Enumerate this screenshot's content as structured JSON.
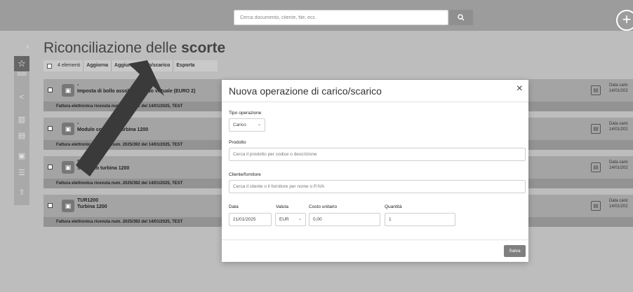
{
  "search": {
    "placeholder": "Cerca documento, cliente, file, ecc."
  },
  "icons": {
    "search": "search-icon",
    "add": "plus-circle-icon",
    "star": "star-icon",
    "share": "share-icon",
    "chart": "chart-icon",
    "stock": "stock-icon",
    "clipboard": "clipboard-icon",
    "list": "list-icon",
    "upload": "cloud-upload-icon"
  },
  "sidebar": {
    "year": "2025"
  },
  "page": {
    "title_prefix": "Riconciliazione delle ",
    "title_bold": "scorte"
  },
  "toolbar": {
    "count": "4 elementi",
    "refresh": "Aggiorna",
    "add_movement": "Aggiungi carico/scarico",
    "export": "Esporta"
  },
  "rows": [
    {
      "code": "-",
      "name": "Imposta di bollo assolta in modo virtuale (EURO 2)",
      "invoice": "Fattura elettronica ricevuta num. 2025/392 del 14/01/2025, TEST",
      "date_label": "Data caric",
      "date": "14/01/202"
    },
    {
      "code": "-",
      "name": "Modulo comando turbina 1200",
      "invoice": "Fattura elettronica ricevuta num. 2025/392 del 14/01/2025, TEST",
      "date_label": "Data caric",
      "date": "14/01/202"
    },
    {
      "code": "STU1200",
      "name": "Supporto turbina 1200",
      "invoice": "Fattura elettronica ricevuta num. 2025/392 del 14/01/2025, TEST",
      "date_label": "Data caric",
      "date": "14/01/202"
    },
    {
      "code": "TUR1200",
      "name": "Turbina 1200",
      "invoice": "Fattura elettronica ricevuta num. 2025/392 del 14/01/2025, TEST",
      "date_label": "Data caric",
      "date": "14/01/202"
    }
  ],
  "modal": {
    "title": "Nuova operazione di carico/scarico",
    "close": "×",
    "type_label": "Tipo operazione",
    "type_value": "Carico",
    "product_label": "Prodotto",
    "product_placeholder": "Cerca il prodotto per codice o descrizione",
    "party_label": "Cliente/fornitore",
    "party_placeholder": "Cerca il cliente o il fornitore per nome o P.IVA",
    "date_label": "Data",
    "date_value": "21/01/2025",
    "currency_label": "Valuta",
    "currency_value": "EUR",
    "cost_label": "Costo unitario",
    "cost_value": "0,00",
    "qty_label": "Quantità",
    "qty_value": "1",
    "save": "Salva"
  }
}
